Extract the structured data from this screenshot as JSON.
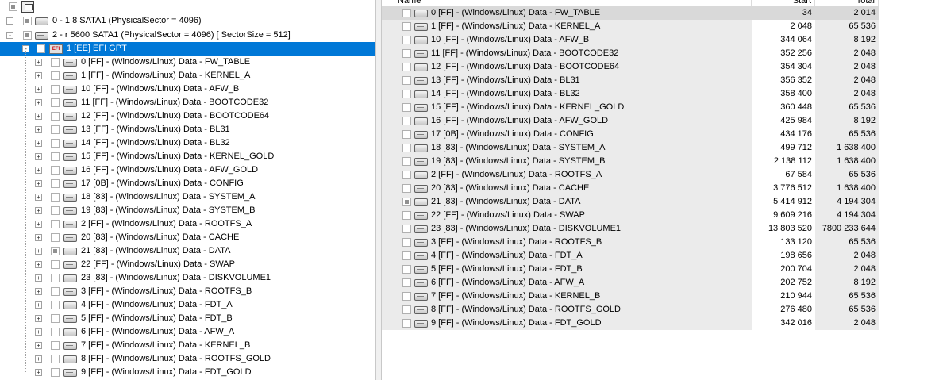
{
  "tree": {
    "disks": [
      {
        "label": "0 -    1    8 SATA1 (PhysicalSector = 4096)",
        "expander": "+"
      },
      {
        "label": "2 -  r 5600 SATA1 (PhysicalSector = 4096) [ SectorSize =  512]",
        "expander": "-"
      }
    ],
    "efi": {
      "label": "1 [EE] EFI GPT",
      "icon_text": "EFI",
      "expander": "-"
    },
    "partitions": [
      "0 [FF] - (Windows/Linux) Data - FW_TABLE",
      "1 [FF] - (Windows/Linux) Data - KERNEL_A",
      "10 [FF] - (Windows/Linux) Data - AFW_B",
      "11 [FF] - (Windows/Linux) Data - BOOTCODE32",
      "12 [FF] - (Windows/Linux) Data - BOOTCODE64",
      "13 [FF] - (Windows/Linux) Data - BL31",
      "14 [FF] - (Windows/Linux) Data - BL32",
      "15 [FF] - (Windows/Linux) Data - KERNEL_GOLD",
      "16 [FF] - (Windows/Linux) Data - AFW_GOLD",
      "17 [0B] - (Windows/Linux) Data - CONFIG",
      "18 [83] - (Windows/Linux) Data - SYSTEM_A",
      "19 [83] - (Windows/Linux) Data - SYSTEM_B",
      "2 [FF] - (Windows/Linux) Data - ROOTFS_A",
      "20 [83] - (Windows/Linux) Data - CACHE",
      "21 [83] - (Windows/Linux) Data - DATA",
      "22 [FF] - (Windows/Linux) Data - SWAP",
      "23 [83] - (Windows/Linux) Data - DISKVOLUME1",
      "3 [FF] - (Windows/Linux) Data - ROOTFS_B",
      "4 [FF] - (Windows/Linux) Data - FDT_A",
      "5 [FF] - (Windows/Linux) Data - FDT_B",
      "6 [FF] - (Windows/Linux) Data - AFW_A",
      "7 [FF] - (Windows/Linux) Data - KERNEL_B",
      "8 [FF] - (Windows/Linux) Data - ROOTFS_GOLD",
      "9 [FF] - (Windows/Linux) Data - FDT_GOLD"
    ],
    "partial_checked_index": 14
  },
  "list": {
    "columns": {
      "name": "Name",
      "start": "Start",
      "total": "Total"
    },
    "rows": [
      {
        "name": "0 [FF] - (Windows/Linux) Data - FW_TABLE",
        "start": "34",
        "total": "2 014"
      },
      {
        "name": "1 [FF] - (Windows/Linux) Data - KERNEL_A",
        "start": "2 048",
        "total": "65 536"
      },
      {
        "name": "10 [FF] - (Windows/Linux) Data - AFW_B",
        "start": "344 064",
        "total": "8 192"
      },
      {
        "name": "11 [FF] - (Windows/Linux) Data - BOOTCODE32",
        "start": "352 256",
        "total": "2 048"
      },
      {
        "name": "12 [FF] - (Windows/Linux) Data - BOOTCODE64",
        "start": "354 304",
        "total": "2 048"
      },
      {
        "name": "13 [FF] - (Windows/Linux) Data - BL31",
        "start": "356 352",
        "total": "2 048"
      },
      {
        "name": "14 [FF] - (Windows/Linux) Data - BL32",
        "start": "358 400",
        "total": "2 048"
      },
      {
        "name": "15 [FF] - (Windows/Linux) Data - KERNEL_GOLD",
        "start": "360 448",
        "total": "65 536"
      },
      {
        "name": "16 [FF] - (Windows/Linux) Data - AFW_GOLD",
        "start": "425 984",
        "total": "8 192"
      },
      {
        "name": "17 [0B] - (Windows/Linux) Data - CONFIG",
        "start": "434 176",
        "total": "65 536"
      },
      {
        "name": "18 [83] - (Windows/Linux) Data - SYSTEM_A",
        "start": "499 712",
        "total": "1 638 400"
      },
      {
        "name": "19 [83] - (Windows/Linux) Data - SYSTEM_B",
        "start": "2 138 112",
        "total": "1 638 400"
      },
      {
        "name": "2 [FF] - (Windows/Linux) Data - ROOTFS_A",
        "start": "67 584",
        "total": "65 536"
      },
      {
        "name": "20 [83] - (Windows/Linux) Data - CACHE",
        "start": "3 776 512",
        "total": "1 638 400"
      },
      {
        "name": "21 [83] - (Windows/Linux) Data - DATA",
        "start": "5 414 912",
        "total": "4 194 304"
      },
      {
        "name": "22 [FF] - (Windows/Linux) Data - SWAP",
        "start": "9 609 216",
        "total": "4 194 304"
      },
      {
        "name": "23 [83] - (Windows/Linux) Data - DISKVOLUME1",
        "start": "13 803 520",
        "total": "7800 233 644"
      },
      {
        "name": "3 [FF] - (Windows/Linux) Data - ROOTFS_B",
        "start": "133 120",
        "total": "65 536"
      },
      {
        "name": "4 [FF] - (Windows/Linux) Data - FDT_A",
        "start": "198 656",
        "total": "2 048"
      },
      {
        "name": "5 [FF] - (Windows/Linux) Data - FDT_B",
        "start": "200 704",
        "total": "2 048"
      },
      {
        "name": "6 [FF] - (Windows/Linux) Data - AFW_A",
        "start": "202 752",
        "total": "8 192"
      },
      {
        "name": "7 [FF] - (Windows/Linux) Data - KERNEL_B",
        "start": "210 944",
        "total": "65 536"
      },
      {
        "name": "8 [FF] - (Windows/Linux) Data - ROOTFS_GOLD",
        "start": "276 480",
        "total": "65 536"
      },
      {
        "name": "9 [FF] - (Windows/Linux) Data - FDT_GOLD",
        "start": "342 016",
        "total": "2 048"
      }
    ],
    "partial_checked_index": 14
  },
  "colors": {
    "selection": "#0078d7",
    "row_shade": "#ebebeb"
  },
  "icons": {
    "disk": "hard-disk-icon",
    "efi": "efi-partition-icon",
    "root": "computer-icon"
  }
}
